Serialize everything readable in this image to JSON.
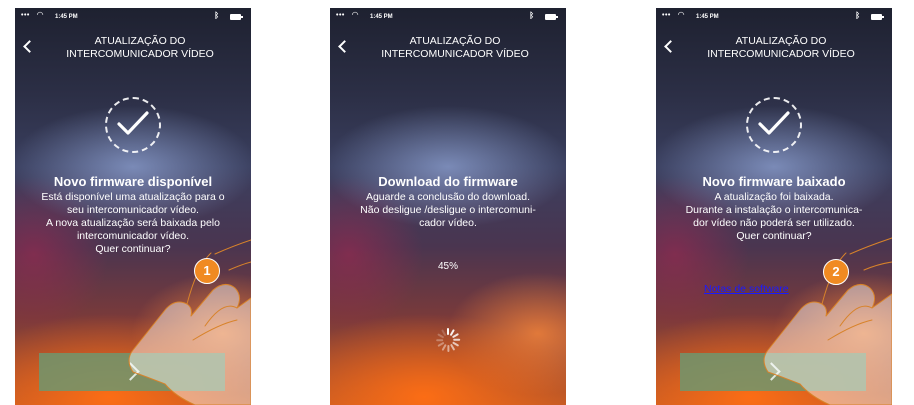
{
  "status_bar": {
    "time": "1:45 PM",
    "dots": "•••"
  },
  "screens": [
    {
      "header": [
        "ATUALIZAÇÃO DO",
        "INTERCOMUNICADOR VÍDEO"
      ],
      "title": "Novo firmware disponível",
      "description": [
        "Está disponível uma atualização para o",
        "seu intercomunicador vídeo.",
        "A nova atualização será baixada pelo",
        "intercomunicador vídeo.",
        "Quer continuar?"
      ],
      "step": "1"
    },
    {
      "header": [
        "ATUALIZAÇÃO DO",
        "INTERCOMUNICADOR VÍDEO"
      ],
      "title": "Download do firmware",
      "description": [
        "Aguarde a conclusão do download.",
        "Não desligue /desligue o intercomuni-",
        "cador vídeo."
      ],
      "progress": "45%"
    },
    {
      "header": [
        "ATUALIZAÇÃO DO",
        "INTERCOMUNICADOR VÍDEO"
      ],
      "title": "Novo firmware baixado",
      "description": [
        "A atualização foi baixada.",
        "Durante a instalação o intercomunica-",
        "dor vídeo não poderá ser utilizado.",
        "Quer continuar?"
      ],
      "link": "Notas de software",
      "step": "2"
    }
  ]
}
